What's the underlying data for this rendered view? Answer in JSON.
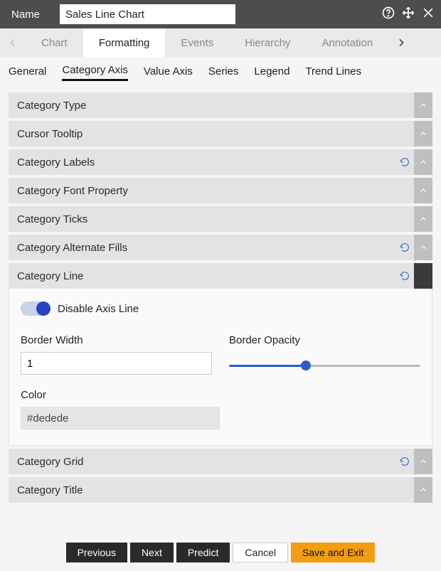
{
  "header": {
    "name_label": "Name",
    "name_value": "Sales Line Chart"
  },
  "tabs": {
    "items": [
      "Chart",
      "Formatting",
      "Events",
      "Hierarchy",
      "Annotation"
    ],
    "active_index": 1
  },
  "subtabs": {
    "items": [
      "General",
      "Category Axis",
      "Value Axis",
      "Series",
      "Legend",
      "Trend Lines"
    ],
    "active_index": 1
  },
  "sections": [
    {
      "title": "Category Type",
      "reset": false,
      "expanded": false
    },
    {
      "title": "Cursor Tooltip",
      "reset": false,
      "expanded": false
    },
    {
      "title": "Category Labels",
      "reset": true,
      "expanded": false
    },
    {
      "title": "Category Font Property",
      "reset": false,
      "expanded": false
    },
    {
      "title": "Category Ticks",
      "reset": false,
      "expanded": false
    },
    {
      "title": "Category Alternate Fills",
      "reset": true,
      "expanded": false
    },
    {
      "title": "Category Line",
      "reset": true,
      "expanded": true
    },
    {
      "title": "Category Grid",
      "reset": true,
      "expanded": false
    },
    {
      "title": "Category Title",
      "reset": false,
      "expanded": false
    }
  ],
  "category_line": {
    "disable_label": "Disable Axis Line",
    "disable_value": true,
    "border_width_label": "Border Width",
    "border_width_value": "1",
    "border_opacity_label": "Border Opacity",
    "border_opacity_percent": 40,
    "color_label": "Color",
    "color_value": "#dedede"
  },
  "footer": {
    "previous": "Previous",
    "next": "Next",
    "predict": "Predict",
    "cancel": "Cancel",
    "save": "Save and Exit"
  }
}
